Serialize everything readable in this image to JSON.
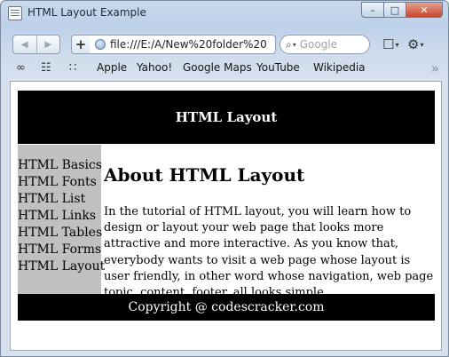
{
  "window": {
    "title": "HTML Layout Example",
    "minimize_glyph": "–",
    "maximize_glyph": "□",
    "close_glyph": "✕"
  },
  "toolbar": {
    "back_glyph": "◀",
    "forward_glyph": "▶",
    "add_glyph": "+",
    "url": "file:///E:/A/New%20folder%20",
    "search_placeholder": "Google",
    "search_glyph": "⌕",
    "page_menu_glyph": "☐",
    "settings_glyph": "⚙",
    "caret_glyph": "▾"
  },
  "bookmarks": {
    "reading_list_glyph": "∞",
    "bookmarks_glyph": "☷",
    "top_sites_glyph": "∷",
    "items": [
      "Apple",
      "Yahoo!",
      "Google Maps",
      "YouTube",
      "Wikipedia"
    ],
    "more_glyph": "»"
  },
  "page": {
    "header_title": "HTML Layout",
    "nav_links": [
      "HTML Basics",
      "HTML Fonts",
      "HTML List",
      "HTML Links",
      "HTML Tables",
      "HTML Forms",
      "HTML Layout"
    ],
    "heading": "About HTML Layout",
    "paragraph": "In the tutorial of HTML layout, you will learn how to design or layout your web page that looks more attractive and more interactive. As you know that, everybody wants to visit a web page whose layout is user friendly, in other word whose navigation, web page topic, content, footer, all looks simple.",
    "footer": "Copyright @ codescracker.com"
  },
  "colors": {
    "header_bg": "#000000",
    "nav_bg": "#c0c0c0",
    "footer_bg": "#000000",
    "close_button": "#c4452c"
  }
}
